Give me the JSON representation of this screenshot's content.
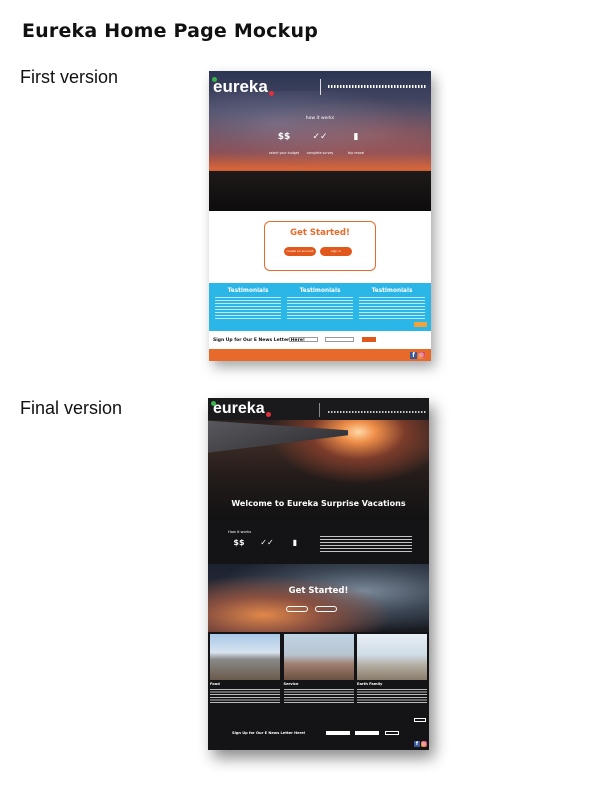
{
  "page_title": "Eureka Home Page Mockup",
  "labels": {
    "first": "First version",
    "final": "Final version"
  },
  "brand": {
    "name": "eureka",
    "accent_orange": "#e86a2a",
    "accent_blue": "#2ab6e6",
    "dot_green": "#3cb34a",
    "dot_red": "#e0303a"
  },
  "first_version": {
    "how_title": "how it works",
    "steps": [
      {
        "icon": "dollar-icon",
        "glyph": "$$",
        "caption": "select your budget"
      },
      {
        "icon": "check-icon",
        "glyph": "✓✓",
        "caption": "complete survey"
      },
      {
        "icon": "map-icon",
        "glyph": "▮",
        "caption": "trip reveal"
      }
    ],
    "get_started": "Get Started!",
    "buttons": [
      "create an account",
      "sign in"
    ],
    "testimonials": [
      "Testimonials",
      "Testimonials",
      "Testimonials"
    ],
    "newsletter": "Sign Up for Our E News Letter Here!"
  },
  "final_version": {
    "welcome": "Welcome to Eureka Surprise Vacations",
    "how_title": "How it works",
    "steps": [
      {
        "icon": "dollar-icon",
        "glyph": "$$"
      },
      {
        "icon": "check-icon",
        "glyph": "✓✓"
      },
      {
        "icon": "map-icon",
        "glyph": "▮"
      }
    ],
    "get_started": "Get Started!",
    "columns": [
      "Food",
      "Service",
      "Earth Family"
    ],
    "newsletter": "Sign Up for Our E News Letter Here!"
  }
}
